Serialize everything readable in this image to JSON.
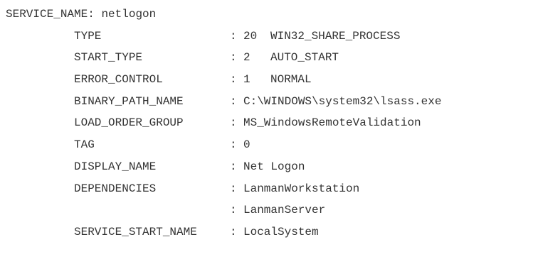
{
  "console": {
    "header_label": "SERVICE_NAME:",
    "header_value": "netlogon",
    "fields": [
      {
        "key": "TYPE",
        "sep": ":",
        "code": "20",
        "value": "WIN32_SHARE_PROCESS"
      },
      {
        "key": "START_TYPE",
        "sep": ":",
        "code": "2",
        "value": "AUTO_START"
      },
      {
        "key": "ERROR_CONTROL",
        "sep": ":",
        "code": "1",
        "value": "NORMAL"
      },
      {
        "key": "BINARY_PATH_NAME",
        "sep": ":",
        "value": "C:\\WINDOWS\\system32\\lsass.exe"
      },
      {
        "key": "LOAD_ORDER_GROUP",
        "sep": ":",
        "value": "MS_WindowsRemoteValidation"
      },
      {
        "key": "TAG",
        "sep": ":",
        "value": "0"
      },
      {
        "key": "DISPLAY_NAME",
        "sep": ":",
        "value": "Net Logon"
      },
      {
        "key": "DEPENDENCIES",
        "sep": ":",
        "value": "LanmanWorkstation"
      },
      {
        "key": "",
        "sep": ":",
        "value": "LanmanServer"
      },
      {
        "key": "SERVICE_START_NAME",
        "sep": ":",
        "value": "LocalSystem"
      }
    ]
  }
}
